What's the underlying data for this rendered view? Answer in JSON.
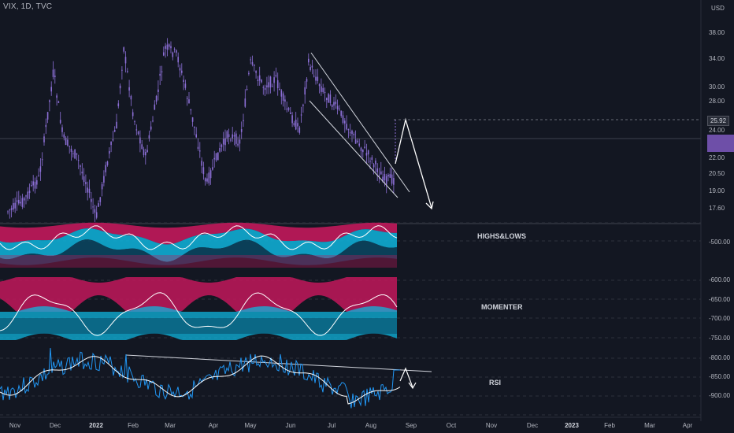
{
  "header": {
    "symbol_line": "VIX, 1D, TVC"
  },
  "currency": "USD",
  "price_axis": [
    "38.00",
    "34.00",
    "30.00",
    "28.00",
    "24.00",
    "22.00",
    "20.50",
    "19.00",
    "17.60"
  ],
  "price_badge": "25.92",
  "last_badge": "",
  "osc_axis": [
    "-500.00",
    "-600.00",
    "-650.00",
    "-700.00",
    "-750.00",
    "-800.00",
    "-850.00",
    "-900.00"
  ],
  "time_axis": [
    "Nov",
    "Dec",
    "2022",
    "Feb",
    "Mar",
    "Apr",
    "May",
    "Jun",
    "Jul",
    "Aug",
    "Sep",
    "Oct",
    "Nov",
    "Dec",
    "2023",
    "Feb",
    "Mar",
    "Apr"
  ],
  "panes": {
    "highs_lows": "HIGHS&LOWS",
    "momenter": "MOMENTER",
    "rsi": "RSI"
  },
  "colors": {
    "background": "#131722",
    "candle": "#8c6fd6",
    "bear_band": "#c2185b",
    "bull_band": "#0fb5dd",
    "line": "#ffffff",
    "rsi_line": "#2196f3"
  }
}
